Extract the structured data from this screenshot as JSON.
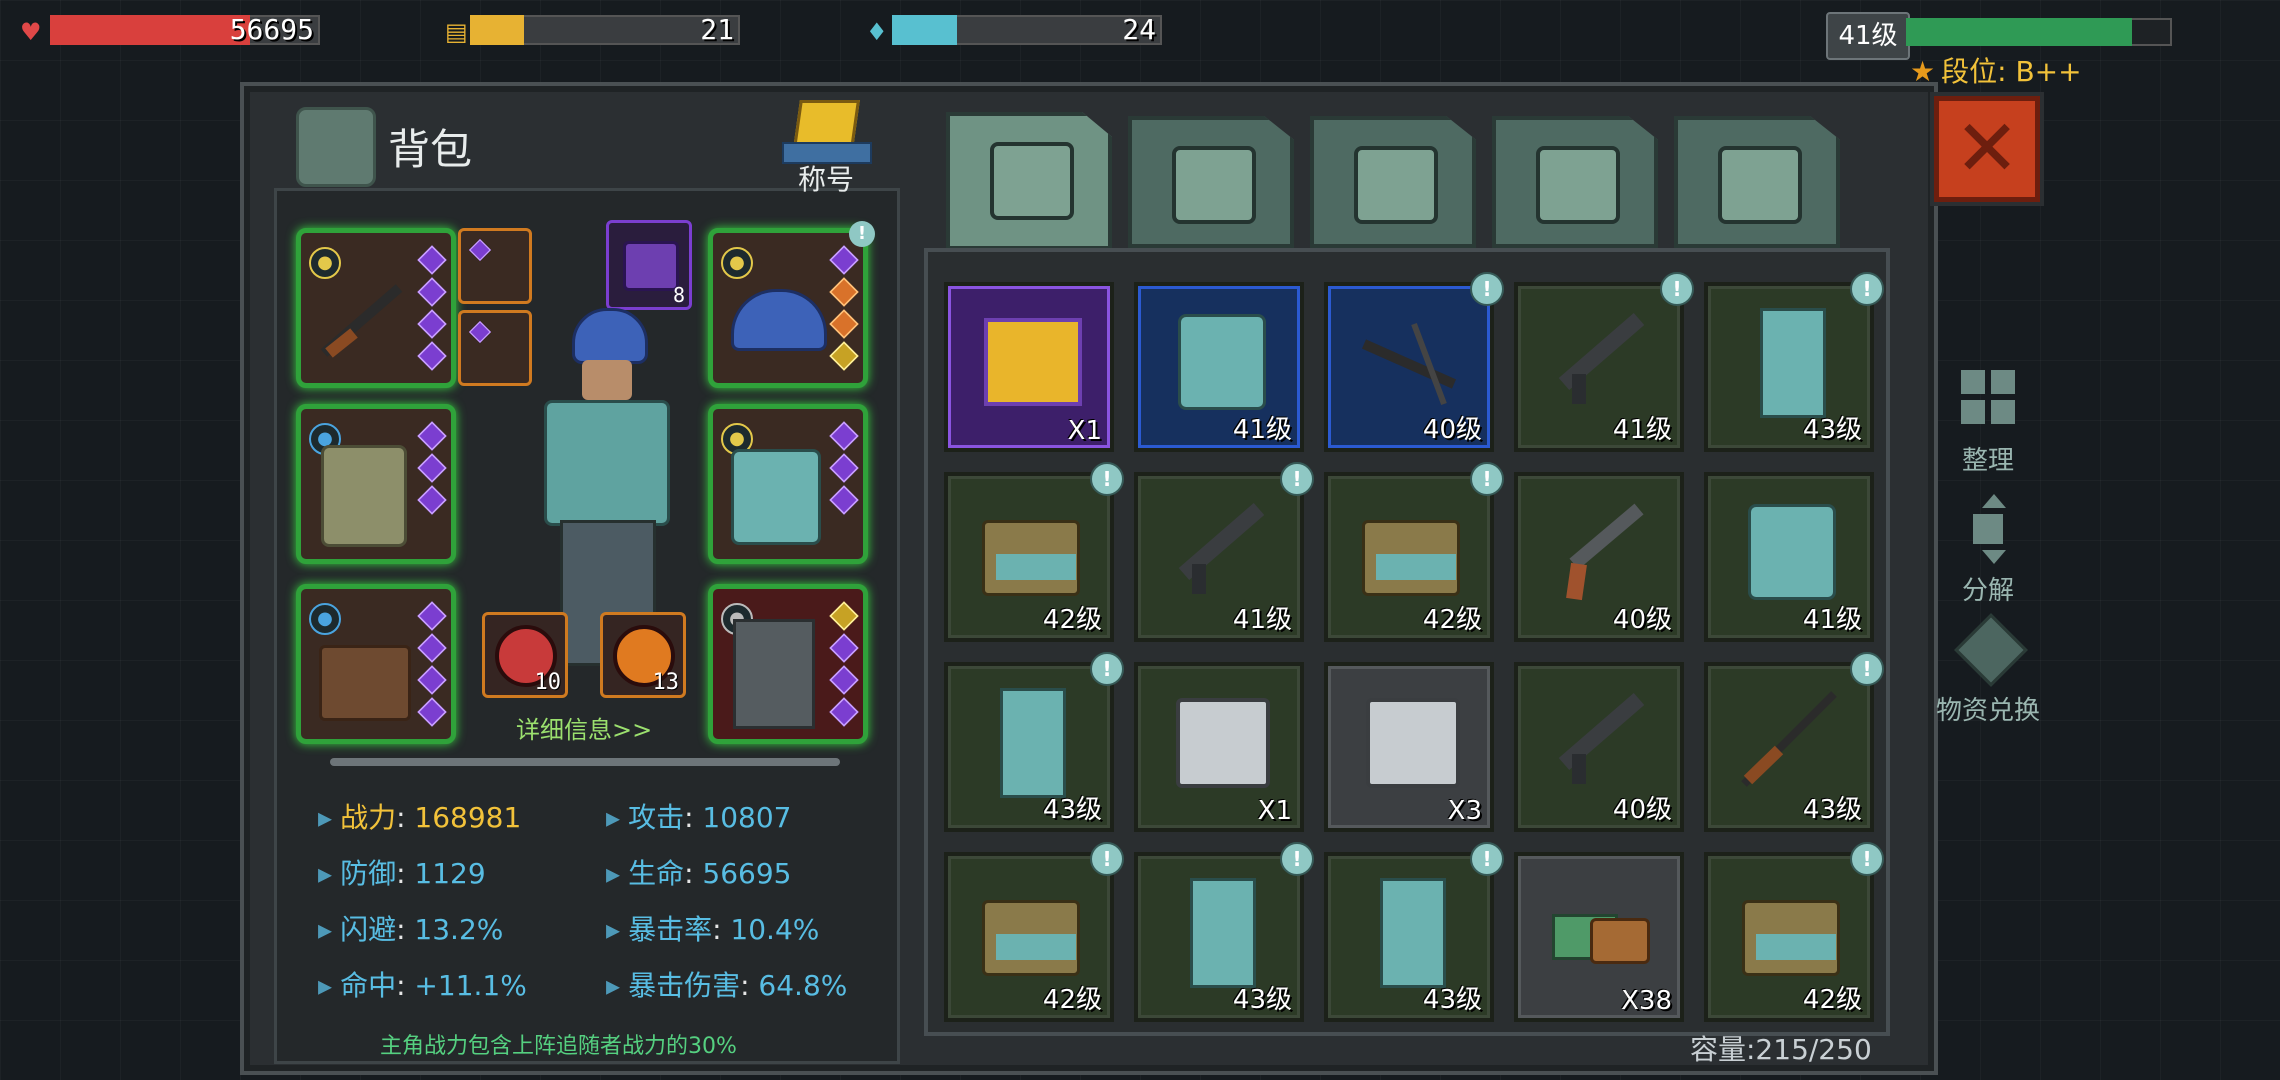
{
  "hud": {
    "health": {
      "value": "56695",
      "fill": 0.74,
      "color": "#d9403d"
    },
    "food": {
      "value": "21",
      "fill": 0.2,
      "color": "#e7b233"
    },
    "water": {
      "value": "24",
      "fill": 0.24,
      "color": "#58c0d0"
    },
    "level_label": "41级",
    "xp_fill": 0.85,
    "rank_label": "段位: B++"
  },
  "panel": {
    "title": "背包",
    "title_badge_label": "称号",
    "detail_link": "详细信息>>",
    "footer_note": "主角战力包含上阵追随者战力的30%",
    "capacity": "容量:215/250"
  },
  "stats": [
    {
      "key": "战力",
      "value": "168981",
      "gold": true
    },
    {
      "key": "攻击",
      "value": "10807"
    },
    {
      "key": "防御",
      "value": "1129"
    },
    {
      "key": "生命",
      "value": "56695"
    },
    {
      "key": "闪避",
      "value": "13.2%"
    },
    {
      "key": "暴击率",
      "value": "10.4%"
    },
    {
      "key": "命中",
      "value": "+11.1%"
    },
    {
      "key": "暴击伤害",
      "value": "64.8%"
    }
  ],
  "equipment_counts": {
    "backpack_small": "8",
    "round_left": "10",
    "round_right": "13"
  },
  "tabs": [
    "backpack-icon",
    "medkit-icon",
    "armor-icon",
    "gun-icon",
    "tools-icon"
  ],
  "side_actions": [
    {
      "label": "整理",
      "icon": "sort-icon"
    },
    {
      "label": "分解",
      "icon": "dismantle-icon"
    },
    {
      "label": "物资兑换",
      "icon": "exchange-icon"
    }
  ],
  "inventory": [
    {
      "label": "X1",
      "kind": "crate",
      "rarity": "purple",
      "new": false
    },
    {
      "label": "41级",
      "kind": "armor",
      "rarity": "blue",
      "new": false
    },
    {
      "label": "40级",
      "kind": "crossbow",
      "rarity": "blue",
      "new": true
    },
    {
      "label": "41级",
      "kind": "pistol",
      "rarity": "green",
      "new": true
    },
    {
      "label": "43级",
      "kind": "pants",
      "rarity": "green",
      "new": true
    },
    {
      "label": "42级",
      "kind": "boots",
      "rarity": "green",
      "new": true
    },
    {
      "label": "41级",
      "kind": "pistol",
      "rarity": "green",
      "new": true
    },
    {
      "label": "42级",
      "kind": "boots",
      "rarity": "green",
      "new": true
    },
    {
      "label": "40级",
      "kind": "revolver",
      "rarity": "green",
      "new": false
    },
    {
      "label": "41级",
      "kind": "armor",
      "rarity": "green",
      "new": false
    },
    {
      "label": "43级",
      "kind": "pants",
      "rarity": "green",
      "new": true
    },
    {
      "label": "X1",
      "kind": "machine",
      "rarity": "green",
      "new": false
    },
    {
      "label": "X3",
      "kind": "machine",
      "rarity": "gray",
      "new": false
    },
    {
      "label": "40级",
      "kind": "pistol",
      "rarity": "green",
      "new": false
    },
    {
      "label": "43级",
      "kind": "rifle",
      "rarity": "green",
      "new": true
    },
    {
      "label": "42级",
      "kind": "boots",
      "rarity": "green",
      "new": true
    },
    {
      "label": "43级",
      "kind": "pants",
      "rarity": "green",
      "new": true
    },
    {
      "label": "43级",
      "kind": "pants",
      "rarity": "green",
      "new": true
    },
    {
      "label": "X38",
      "kind": "food",
      "rarity": "gray",
      "new": false
    },
    {
      "label": "42级",
      "kind": "boots",
      "rarity": "green",
      "new": true
    }
  ]
}
